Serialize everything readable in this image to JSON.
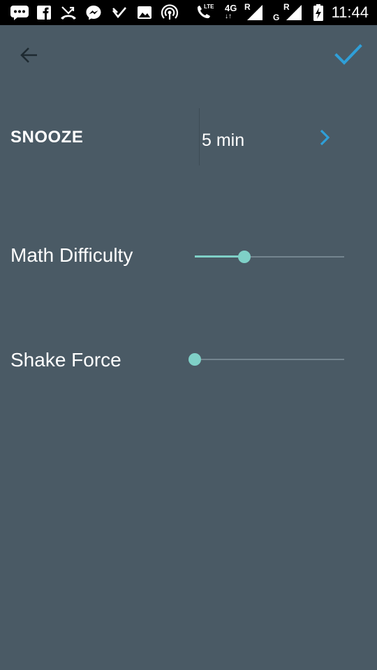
{
  "status_bar": {
    "network_4g": "4G",
    "roaming_1": "R",
    "roaming_2": "R",
    "network_g": "G",
    "lte": "LTE",
    "time": "11:44",
    "icons": [
      "chat-icon",
      "facebook-icon",
      "missed-call-icon",
      "messenger-icon",
      "check-icon",
      "image-icon",
      "hotspot-icon",
      "call-icon",
      "signal-icon",
      "signal-icon",
      "battery-charging-icon"
    ]
  },
  "toolbar": {
    "back_icon": "arrow-back-icon",
    "confirm_icon": "check-icon",
    "accent_color": "#2f9fd8"
  },
  "snooze": {
    "label": "SNOOZE",
    "value": "5 min",
    "chevron_icon": "chevron-right-icon"
  },
  "sliders": [
    {
      "label": "Math Difficulty",
      "level": 0.33
    },
    {
      "label": "Shake Force",
      "level": 0.0
    }
  ],
  "colors": {
    "background": "#4a5a65",
    "slider_active": "#7fd0c7",
    "slider_track": "#74858f"
  }
}
